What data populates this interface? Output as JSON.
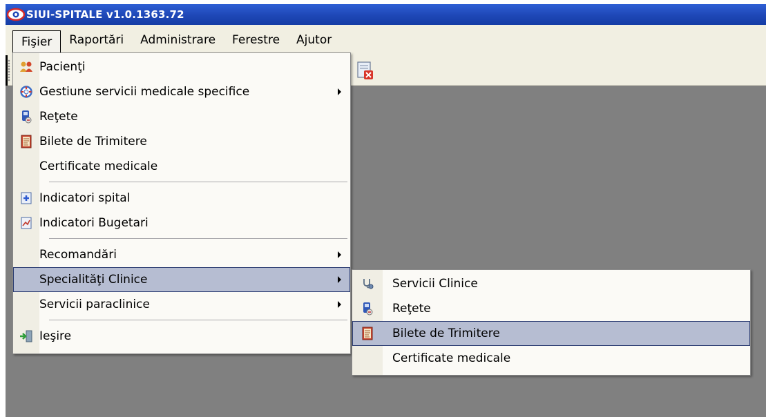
{
  "window": {
    "title": "SIUI-SPITALE v1.0.1363.72"
  },
  "menubar": {
    "items": [
      {
        "label": "Fişier"
      },
      {
        "label": "Raportări"
      },
      {
        "label": "Administrare"
      },
      {
        "label": "Ferestre"
      },
      {
        "label": "Ajutor"
      }
    ]
  },
  "file_menu": {
    "items": [
      {
        "label": "Pacienţi",
        "icon": "patients-icon"
      },
      {
        "label": "Gestiune servicii medicale specifice",
        "icon": "lifebuoy-icon"
      },
      {
        "label": "Reţete",
        "icon": "prescription-icon"
      },
      {
        "label": "Bilete de Trimitere",
        "icon": "referral-document-icon"
      },
      {
        "label": "Certificate medicale"
      },
      {
        "label": "Indicatori spital",
        "icon": "hospital-indicator-icon"
      },
      {
        "label": "Indicatori Bugetari",
        "icon": "budget-chart-icon"
      },
      {
        "label": "Recomandări"
      },
      {
        "label": "Specialităţi Clinice"
      },
      {
        "label": "Servicii paraclinice"
      },
      {
        "label": "Ieşire",
        "icon": "exit-door-icon"
      }
    ]
  },
  "submenu": {
    "items": [
      {
        "label": "Servicii Clinice",
        "icon": "stethoscope-icon"
      },
      {
        "label": "Reţete",
        "icon": "prescription-icon"
      },
      {
        "label": "Bilete de Trimitere",
        "icon": "referral-document-icon"
      },
      {
        "label": "Certificate medicale"
      }
    ]
  },
  "colors": {
    "title_bar": "#1e47b6",
    "menu_bar": "#f1efe2",
    "workspace": "#808080",
    "highlight": "#b6bdd2",
    "highlight_border": "#2d3e73"
  }
}
